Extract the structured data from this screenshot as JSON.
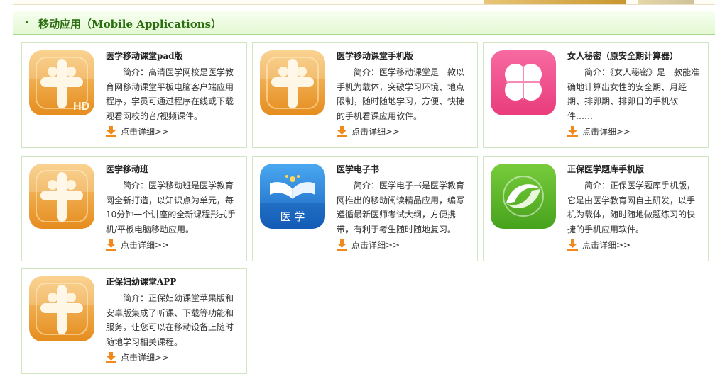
{
  "section": {
    "bullet": "•",
    "title": "移动应用（Mobile Applications）"
  },
  "colors": {
    "header_green": "#2a6e10",
    "border_green": "#7fbf5f",
    "download_orange": "#f08a1c",
    "pink": "#f0508c",
    "blue": "#1a70c8",
    "green": "#5db52c"
  },
  "apps": [
    {
      "name": "医学移动课堂pad版",
      "icon": "medical-cross-hd-icon",
      "desc": "简介：高清医学网校是医学教育网移动课堂平板电脑客户端应用程序，学员可通过程序在线或下载观看网校的音/视频课件。",
      "more": "点击详细>>"
    },
    {
      "name": "医学移动课堂手机版",
      "icon": "medical-cross-icon",
      "desc": "简介：医学移动课堂是一款以手机为载体，突破学习环境、地点限制，随时随地学习，方便、快捷的手机看课应用软件。",
      "more": "点击详细>>"
    },
    {
      "name": "女人秘密（原安全期计算器）",
      "icon": "clover-icon",
      "desc": "简介：《女人秘密》是一款能准确地计算出女性的安全期、月经期、排卵期、排卵日的手机软件……",
      "more": "点击详细>>"
    },
    {
      "name": "医学移动班",
      "icon": "medical-cross-icon",
      "desc": "简介：医学移动班是医学教育网全新打造，以知识点为单元，每10分钟一个讲座的全新课程形式手机/平板电脑移动应用。",
      "more": "点击详细>>"
    },
    {
      "name": "医学电子书",
      "icon": "ebook-icon",
      "icon_text": "医 学",
      "desc": "简介：医学电子书是医学教育网推出的移动阅读精品应用，编写遵循最新医师考试大纲，方便携带，有利于考生随时随地复习。",
      "more": "点击详细>>"
    },
    {
      "name": "正保医学题库手机版",
      "icon": "swirl-icon",
      "desc": "简介：正保医学题库手机版，它是由医学教育网自主研发，以手机为载体，随时随地做题练习的快捷的手机应用软件。",
      "more": "点击详细>>"
    },
    {
      "name": "正保妇幼课堂APP",
      "icon": "medical-cross-icon",
      "desc": "简介：正保妇幼课堂苹果版和安卓版集成了听课、下载等功能和服务，让您可以在移动设备上随时随地学习相关课程。",
      "more": "点击详细>>"
    }
  ]
}
